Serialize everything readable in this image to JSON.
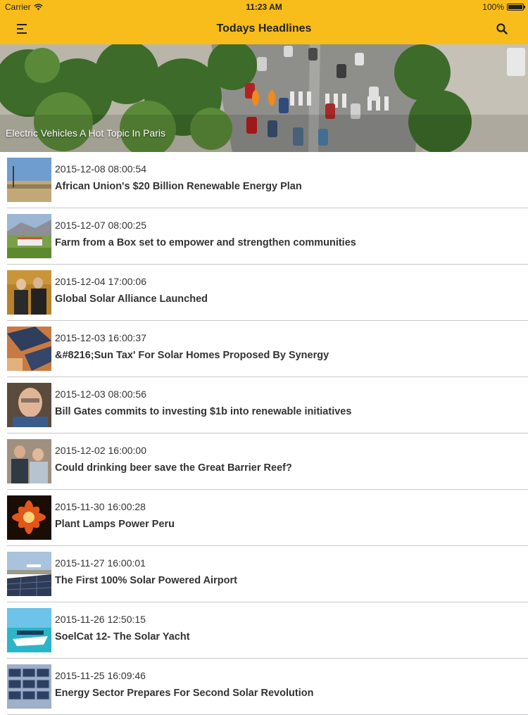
{
  "status_bar": {
    "carrier": "Carrier",
    "time": "11:23 AM",
    "battery": "100%"
  },
  "nav": {
    "title": "Todays Headlines",
    "menu_icon": "hamburger-menu-icon",
    "search_icon": "search-icon"
  },
  "colors": {
    "nav_background": "#f8bd1a",
    "separator": "#c8c7cc",
    "text": "#333333"
  },
  "hero": {
    "caption": "Electric Vehicles A Hot Topic In Paris"
  },
  "articles": [
    {
      "date": "2015-12-08 08:00:54",
      "title": "African Union's $20 Billion Renewable Energy Plan"
    },
    {
      "date": "2015-12-07 08:00:25",
      "title": "Farm from a Box set to empower and strengthen communities"
    },
    {
      "date": "2015-12-04 17:00:06",
      "title": "Global Solar Alliance Launched"
    },
    {
      "date": "2015-12-03 16:00:37",
      "title": "&#8216;Sun Tax' For Solar Homes Proposed By Synergy"
    },
    {
      "date": "2015-12-03 08:00:56",
      "title": "Bill Gates commits to investing $1b into renewable initiatives"
    },
    {
      "date": "2015-12-02 16:00:00",
      "title": "Could drinking beer save the Great Barrier Reef?"
    },
    {
      "date": "2015-11-30 16:00:28",
      "title": "Plant Lamps Power Peru"
    },
    {
      "date": "2015-11-27 16:00:01",
      "title": "The First 100% Solar Powered Airport"
    },
    {
      "date": "2015-11-26 12:50:15",
      "title": "SoelCat 12- The Solar Yacht"
    },
    {
      "date": "2015-11-25 16:09:46",
      "title": "Energy Sector Prepares For Second Solar Revolution"
    }
  ]
}
